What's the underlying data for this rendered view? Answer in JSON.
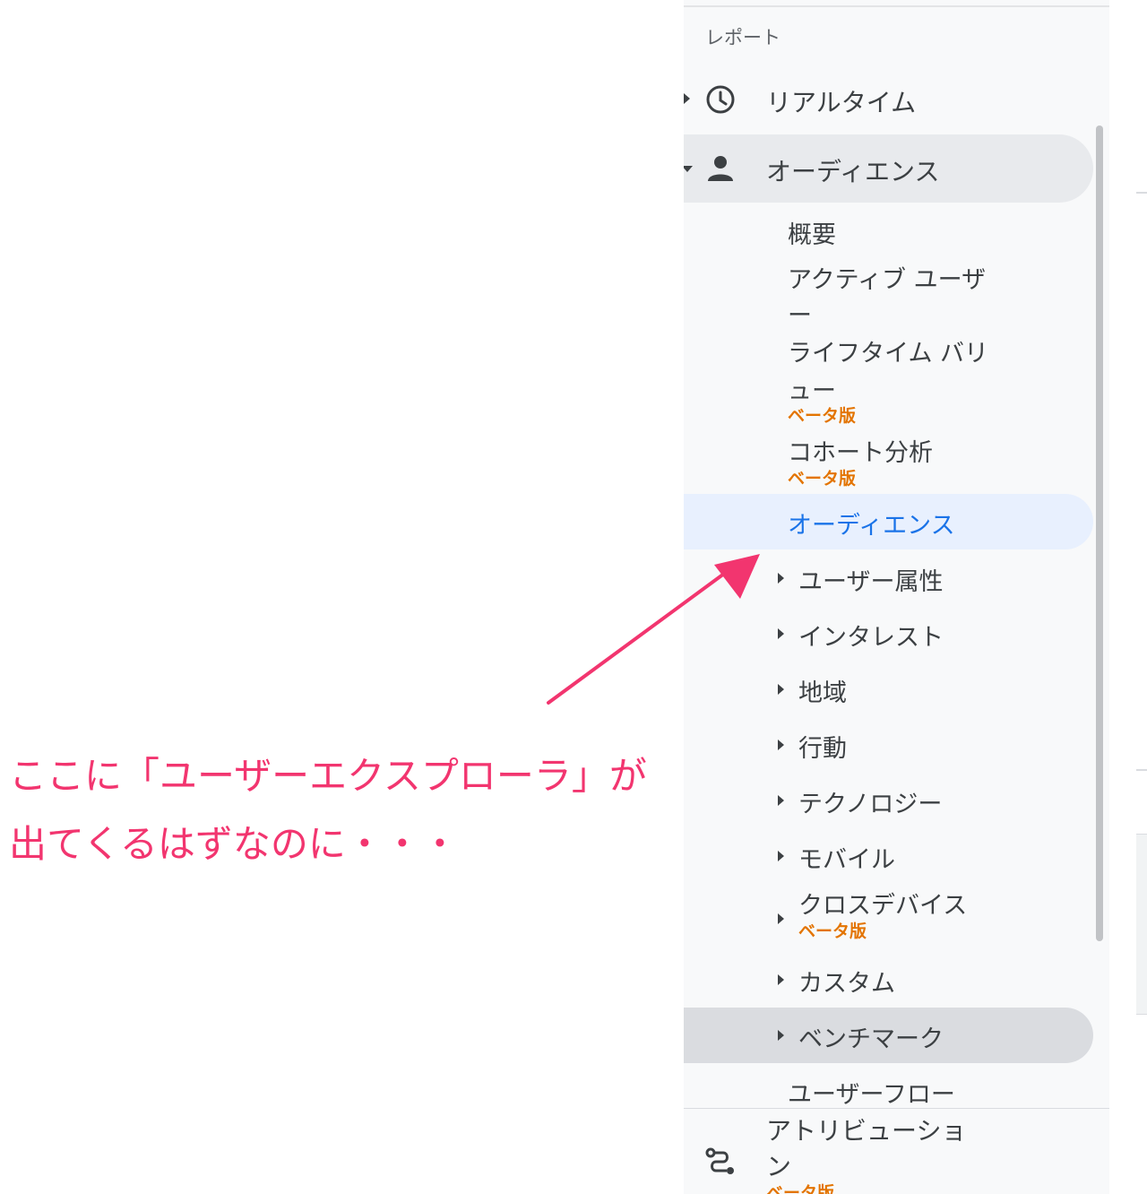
{
  "sidebar": {
    "header": "レポート",
    "realtime": "リアルタイム",
    "audience": "オーディエンス",
    "sub": {
      "overview": "概要",
      "active_users_1": "アクティブ ユーザ",
      "active_users_2": "ー",
      "ltv_1": "ライフタイム バリ",
      "ltv_2": "ュー",
      "ltv_beta": "ベータ版",
      "cohort": "コホート分析",
      "cohort_beta": "ベータ版",
      "audiences": "オーディエンス",
      "demographics": "ユーザー属性",
      "interests": "インタレスト",
      "geo": "地域",
      "behavior": "行動",
      "technology": "テクノロジー",
      "mobile": "モバイル",
      "cross_device": "クロスデバイス",
      "cross_device_beta": "ベータ版",
      "custom": "カスタム",
      "benchmark": "ベンチマーク",
      "user_flow": "ユーザーフロー"
    },
    "attribution_1": "アトリビューショ",
    "attribution_2": "ン",
    "attribution_beta": "ベータ版"
  },
  "annotation": {
    "line1": "ここに「ユーザーエクスプローラ」が",
    "line2": "出てくるはずなのに・・・",
    "color": "#f2356f"
  },
  "colors": {
    "active_text": "#1a73e8",
    "active_bg": "#e8f0fe",
    "beta": "#e37400"
  }
}
